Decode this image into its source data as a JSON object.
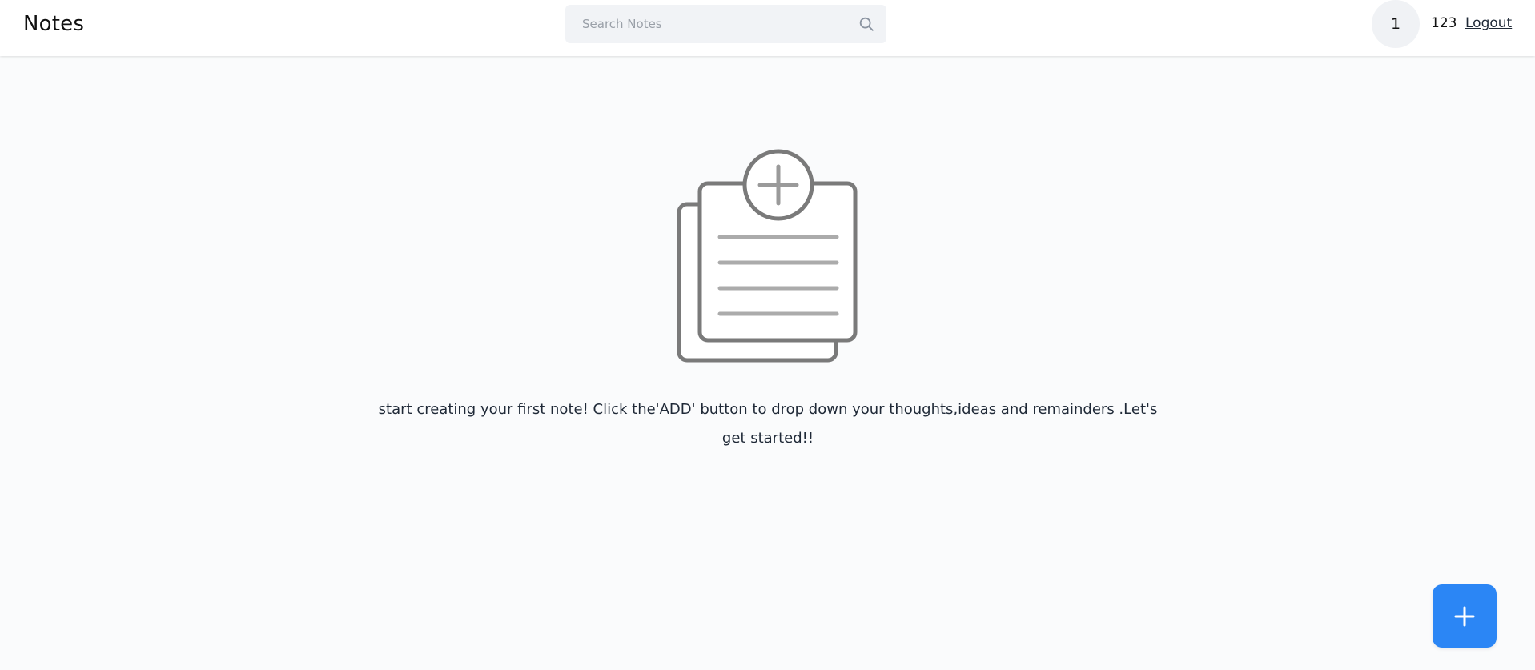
{
  "header": {
    "brand": "Notes",
    "search": {
      "placeholder": "Search Notes",
      "value": ""
    },
    "search_icon": "search-icon",
    "avatar_text": "1",
    "username": "123",
    "logout_label": "Logout"
  },
  "main": {
    "illustration_icon": "add-note-icon",
    "empty_message": "start creating your first note! Click the'ADD' button to drop down your thoughts,ideas and remainders .Let's get started!!"
  },
  "fab": {
    "icon": "plus-icon"
  },
  "colors": {
    "accent": "#2b86f5",
    "background": "#fafbfc",
    "navbar": "#ffffff",
    "search_bg": "#f1f3f6",
    "illustration_stroke": "#7a7a7a",
    "illustration_lines": "#ababab"
  }
}
